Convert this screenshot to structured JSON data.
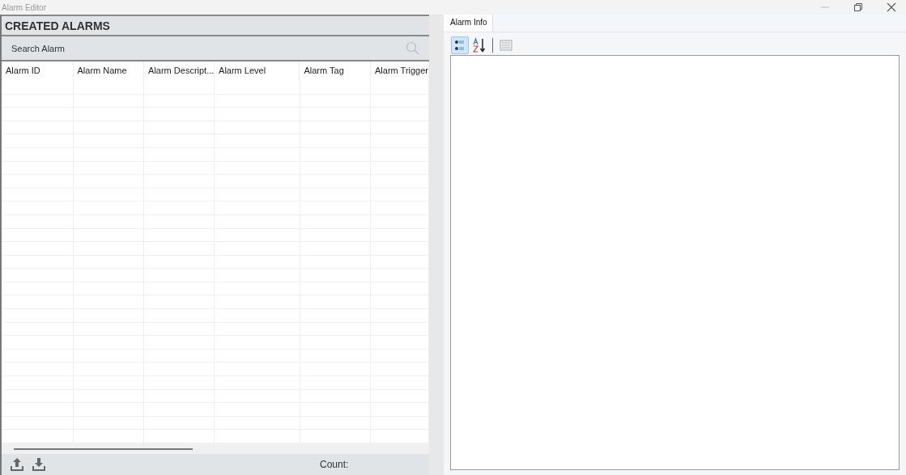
{
  "window": {
    "title": "Alarm Editor"
  },
  "alarms_panel": {
    "title": "CREATED ALARMS",
    "search": {
      "placeholder": "Search Alarm"
    },
    "columns": [
      "Alarm ID",
      "Alarm Name",
      "Alarm Descript...",
      "Alarm Level",
      "Alarm Tag",
      "Alarm Trigger"
    ],
    "footer": {
      "count_label": "Count:"
    }
  },
  "info_panel": {
    "tabs": [
      {
        "label": "Alarm Info",
        "selected": true
      }
    ],
    "toolbar": [
      {
        "kind": "categorized",
        "selected": true,
        "disabled": false
      },
      {
        "kind": "alphabetical",
        "selected": false,
        "disabled": false
      },
      {
        "kind": "property-pages",
        "selected": false,
        "disabled": true
      }
    ]
  }
}
